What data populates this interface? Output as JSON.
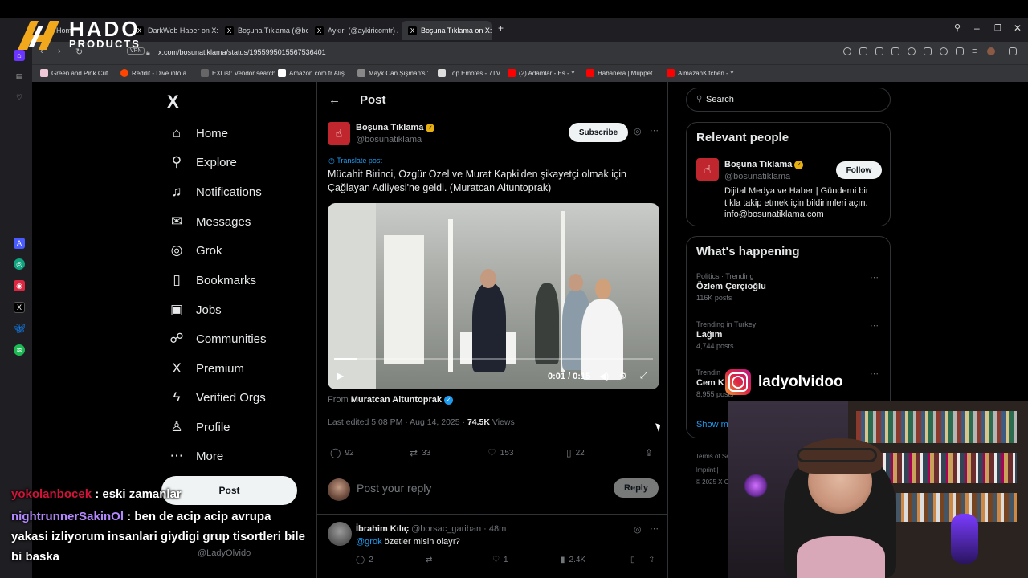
{
  "logo": {
    "line1": "HADO",
    "line2": "PRODUCTS"
  },
  "browser": {
    "tabs": [
      {
        "label": "Home",
        "icon": "X"
      },
      {
        "label": "DarkWeb Haber on X: \"Ö",
        "icon": "X"
      },
      {
        "label": "Boşuna Tıklama (@bosun",
        "icon": "X"
      },
      {
        "label": "Aykırı (@aykiricomtr) / X",
        "icon": "X"
      },
      {
        "label": "Boşuna Tıklama on X: \"Mü",
        "icon": "X"
      }
    ],
    "new_tab": "+",
    "url": "x.com/bosunatiklama/status/1955995015567536401",
    "vpn": "VPN",
    "bookmarks": [
      {
        "label": "Green and Pink Cut...",
        "color": "#f0c7d6"
      },
      {
        "label": "Reddit - Dive into a...",
        "color": "#ff4500"
      },
      {
        "label": "EXList: Vendor search",
        "color": "#666666"
      },
      {
        "label": "Amazon.com.tr Alış...",
        "color": "#ffffff"
      },
      {
        "label": "Mayk Can Şişman's '...",
        "color": "#888888"
      },
      {
        "label": "Top Emotes - 7TV",
        "color": "#dddddd"
      },
      {
        "label": "(2) Adamlar - Es - Y...",
        "color": "#ff0000"
      },
      {
        "label": "Habanera | Muppet...",
        "color": "#ff0000"
      },
      {
        "label": "AlmazanKitchen - Y...",
        "color": "#ff0000"
      }
    ]
  },
  "nav": {
    "logo": "X",
    "items": [
      {
        "label": "Home",
        "icon": "⌂"
      },
      {
        "label": "Explore",
        "icon": "⚲"
      },
      {
        "label": "Notifications",
        "icon": "♫"
      },
      {
        "label": "Messages",
        "icon": "✉"
      },
      {
        "label": "Grok",
        "icon": "◎"
      },
      {
        "label": "Bookmarks",
        "icon": "▯"
      },
      {
        "label": "Jobs",
        "icon": "▣"
      },
      {
        "label": "Communities",
        "icon": "☍"
      },
      {
        "label": "Premium",
        "icon": "X"
      },
      {
        "label": "Verified Orgs",
        "icon": "ϟ"
      },
      {
        "label": "Profile",
        "icon": "♙"
      },
      {
        "label": "More",
        "icon": "⋯"
      }
    ],
    "post_button": "Post",
    "profile_handle": "@LadyOlvido"
  },
  "post": {
    "header_title": "Post",
    "back_icon": "←",
    "author_name": "Boşuna Tıklama",
    "author_handle": "@bosunatiklama",
    "subscribe": "Subscribe",
    "translate": "Translate post",
    "text": "Mücahit Birinci, Özgür Özel ve Murat Kapki'den şikayetçi olmak için Çağlayan Adliyesi'ne geldi. (Muratcan Altuntoprak)",
    "video": {
      "time": "0:01 / 0:15",
      "progress": 0.07
    },
    "from_prefix": "From",
    "from_name": "Muratcan Altuntoprak",
    "edited": "Last edited 5:08 PM · Aug 14, 2025 ·",
    "views_count": "74.5K",
    "views_label": "Views",
    "stats": {
      "replies": "92",
      "reposts": "33",
      "likes": "153",
      "bookmarks": "22"
    },
    "reply_placeholder": "Post your reply",
    "reply_button": "Reply"
  },
  "comment": {
    "name": "İbrahim Kılıç",
    "handle": "@borsac_gariban · 48m",
    "mention": "@grok",
    "text": " özetler misin olayı?",
    "replies": "2",
    "likes": "1",
    "views": "2.4K"
  },
  "sidebar": {
    "search_placeholder": "Search",
    "relevant_title": "Relevant people",
    "person": {
      "name": "Boşuna Tıklama",
      "handle": "@bosunatiklama",
      "follow": "Follow",
      "bio": "Dijital Medya ve Haber | Gündemi bir tıkla takip etmek için bildirimleri açın. info@bosunatiklama.com"
    },
    "happening_title": "What's happening",
    "trends": [
      {
        "category": "Politics · Trending",
        "topic": "Özlem Çerçioğlu",
        "posts": "116K posts"
      },
      {
        "category": "Trending in Turkey",
        "topic": "Lağım",
        "posts": "4,744 posts"
      },
      {
        "category": "Trendin",
        "topic": "Cem K",
        "posts": "8,955 posts"
      }
    ],
    "show_more": "Show m",
    "footer1": "Terms of Se",
    "footer2": "Imprint |",
    "footer3": "© 2025 X C"
  },
  "overlay": {
    "instagram": "ladyolvidoo",
    "chat": [
      {
        "user": "yokolanbocek",
        "msg": " : eski zamanlar"
      },
      {
        "user": "nightrunnerSakinOl",
        "msg": " : ben de acip acip avrupa yakasi izliyorum insanlari giydigi grup tisortleri bile bi baska"
      }
    ]
  }
}
